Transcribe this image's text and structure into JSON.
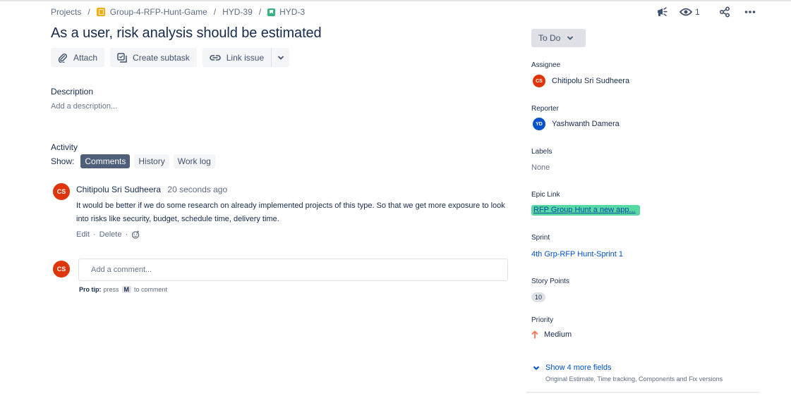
{
  "breadcrumb": {
    "projects": "Projects",
    "project": "Group-4-RFP-Hunt-Game",
    "parent": "HYD-39",
    "issue": "HYD-3",
    "separator": "/"
  },
  "header": {
    "watch_count": "1"
  },
  "issue": {
    "title": "As a user, risk analysis should be estimated"
  },
  "toolbar": {
    "attach": "Attach",
    "create_subtask": "Create subtask",
    "link_issue": "Link issue"
  },
  "description": {
    "label": "Description",
    "placeholder": "Add a description..."
  },
  "activity": {
    "label": "Activity",
    "show_label": "Show:",
    "tabs": [
      {
        "label": "Comments",
        "active": true
      },
      {
        "label": "History",
        "active": false
      },
      {
        "label": "Work log",
        "active": false
      }
    ]
  },
  "comment": {
    "avatar_initials": "CS",
    "author": "Chitipolu Sri Sudheera",
    "time": "20 seconds ago",
    "body": "It would be better if we do some research on already implemented projects of this type.  So that we get more exposure to look into risks like security, budget, schedule time, delivery time.",
    "edit": "Edit",
    "delete": "Delete",
    "dot": "·"
  },
  "new_comment": {
    "avatar_initials": "CS",
    "placeholder": "Add a comment...",
    "pro_tip_label": "Pro tip:",
    "pro_tip_press": "press",
    "pro_tip_key": "M",
    "pro_tip_suffix": "to comment"
  },
  "sidebar": {
    "status": "To Do",
    "assignee_label": "Assignee",
    "assignee_initials": "CS",
    "assignee": "Chitipolu Sri Sudheera",
    "reporter_label": "Reporter",
    "reporter_initials": "YD",
    "reporter": "Yashwanth Damera",
    "labels_label": "Labels",
    "labels_value": "None",
    "epic_label": "Epic Link",
    "epic_value": "RFP Group Hunt a new app...",
    "sprint_label": "Sprint",
    "sprint_value": "4th Grp-RFP Hunt-Sprint 1",
    "story_points_label": "Story Points",
    "story_points_value": "10",
    "priority_label": "Priority",
    "priority_value": "Medium",
    "show_more": "Show 4 more fields",
    "show_more_sub": "Original Estimate, Time tracking, Components and Fix versions"
  },
  "colors": {
    "accent": "#0052cc",
    "avatar_red": "#de350b",
    "avatar_blue": "#0052cc",
    "epic_green": "#57d9a3",
    "priority_orange": "#ff7452"
  }
}
